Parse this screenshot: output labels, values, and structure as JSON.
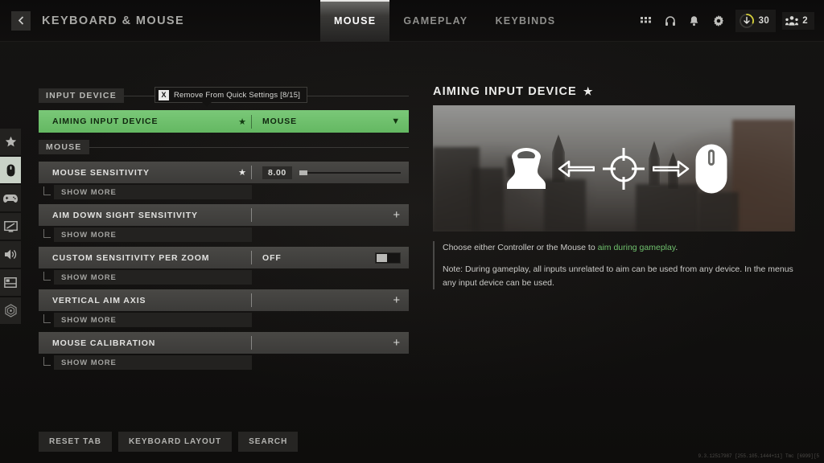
{
  "header": {
    "back_icon": "chevron-left-icon",
    "title": "KEYBOARD & MOUSE",
    "tabs": [
      {
        "label": "MOUSE",
        "active": true
      },
      {
        "label": "GAMEPLAY",
        "active": false
      },
      {
        "label": "KEYBINDS",
        "active": false
      }
    ],
    "sys_icons": [
      "grid-icon",
      "headset-icon",
      "bell-icon",
      "gear-icon"
    ],
    "level_chip": {
      "icon": "level-down-arrow-icon",
      "value": "30"
    },
    "party_chip": {
      "icon": "party-members-icon",
      "value": "2"
    }
  },
  "rail": {
    "items": [
      {
        "name": "favorites",
        "icon": "star-icon",
        "active": false
      },
      {
        "name": "keyboard-mouse",
        "icon": "mouse-icon",
        "active": true
      },
      {
        "name": "controller",
        "icon": "gamepad-icon",
        "active": false
      },
      {
        "name": "graphics",
        "icon": "display-icon",
        "active": false
      },
      {
        "name": "audio",
        "icon": "speaker-icon",
        "active": false
      },
      {
        "name": "interface",
        "icon": "interface-icon",
        "active": false
      },
      {
        "name": "accessibility",
        "icon": "accessibility-icon",
        "active": false
      }
    ]
  },
  "tooltip": {
    "key": "X",
    "text": "Remove From Quick Settings [8/15]"
  },
  "settings": {
    "sections": [
      {
        "header": "INPUT DEVICE",
        "rows": [
          {
            "name": "AIMING INPUT DEVICE",
            "selected": true,
            "star": true,
            "control": "dropdown",
            "value": "MOUSE",
            "chevron": "chevron-down-icon",
            "show_more": null
          }
        ]
      },
      {
        "header": "MOUSE",
        "rows": [
          {
            "name": "MOUSE SENSITIVITY",
            "selected": false,
            "star": true,
            "control": "slider",
            "value": "8.00",
            "fill_percent": 8,
            "show_more": "SHOW MORE"
          },
          {
            "name": "AIM DOWN SIGHT SENSITIVITY",
            "selected": false,
            "star": false,
            "control": "expand",
            "value": "",
            "plus": "+",
            "show_more": "SHOW MORE"
          },
          {
            "name": "CUSTOM SENSITIVITY PER ZOOM",
            "selected": false,
            "star": false,
            "control": "toggle",
            "value": "OFF",
            "toggle_on": false,
            "show_more": "SHOW MORE"
          },
          {
            "name": "VERTICAL AIM AXIS",
            "selected": false,
            "star": false,
            "control": "expand",
            "value": "",
            "plus": "+",
            "show_more": "SHOW MORE"
          },
          {
            "name": "MOUSE CALIBRATION",
            "selected": false,
            "star": false,
            "control": "expand",
            "value": "",
            "plus": "+",
            "show_more": "SHOW MORE"
          }
        ]
      }
    ]
  },
  "detail": {
    "title": "AIMING INPUT DEVICE",
    "starred": true,
    "star_icon": "star-icon",
    "preview_icons": [
      "analog-stick-icon",
      "arrow-left-icon",
      "crosshair-icon",
      "arrow-right-icon",
      "mouse-icon"
    ],
    "desc_line1_pre": "Choose either Controller or the Mouse to ",
    "desc_line1_hl": "aim during gameplay",
    "desc_line1_post": ".",
    "desc_line2": "Note: During gameplay, all inputs unrelated to aim can be used from any device. In the menus any input device can be used."
  },
  "footer": {
    "buttons": [
      "RESET TAB",
      "KEYBOARD LAYOUT",
      "SEARCH"
    ],
    "debug": "9.3.12517987 [255.105.1444+11] Tmc [6999][5"
  },
  "colors": {
    "accent_green": "#6fc06d",
    "selected_row": "#72c470",
    "background": "#131211",
    "row": "#3f3e3b",
    "level_ring": "#d8d23a"
  }
}
